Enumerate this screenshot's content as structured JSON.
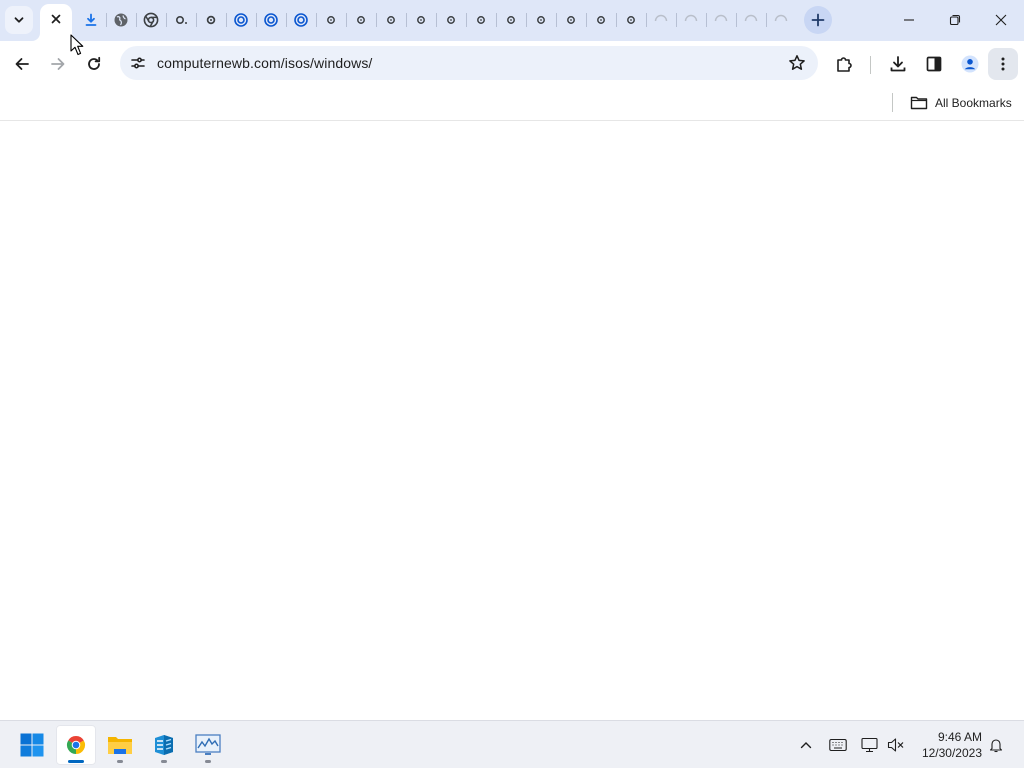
{
  "browser": {
    "address_bar": {
      "url": "computernewb.com/isos/windows/"
    },
    "bookmarks_bar": {
      "all_bookmarks_label": "All Bookmarks"
    }
  },
  "taskbar": {
    "clock": {
      "time": "9:46 AM",
      "date": "12/30/2023"
    },
    "apps": [
      "windows-start",
      "chrome",
      "file-explorer",
      "stack-app",
      "performance-monitor"
    ]
  },
  "colors": {
    "tabstrip_bg": "#dfe7f8",
    "omnibox_bg": "#ecf1fa",
    "new_tab_bg": "#c8d6f4",
    "accent_blue": "#0b57d0",
    "taskbar_bg": "#eef0f5",
    "taskbar_active_indicator": "#0067c0"
  }
}
